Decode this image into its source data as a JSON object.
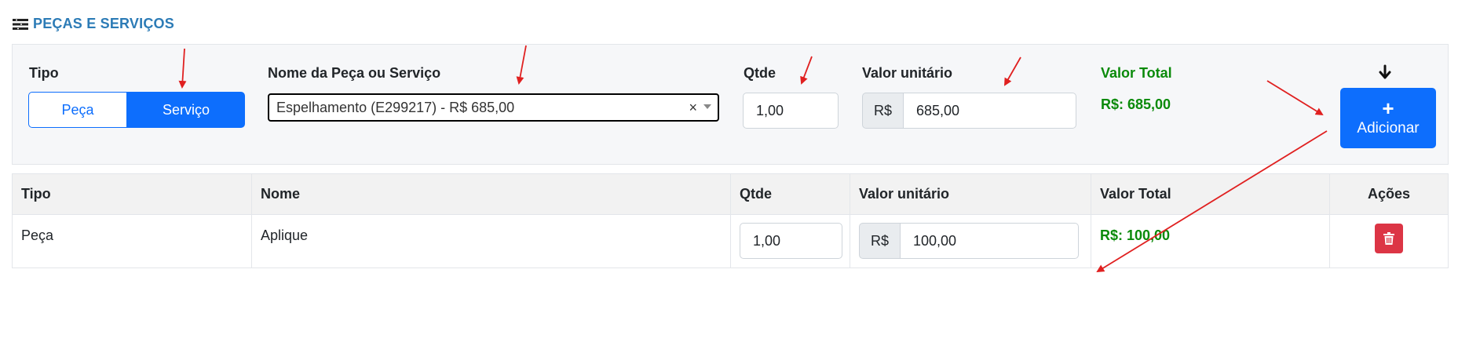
{
  "section": {
    "title": "PEÇAS E SERVIÇOS",
    "icon": "list-icon"
  },
  "form": {
    "tipo_label": "Tipo",
    "tipo_options": [
      "Peça",
      "Serviço"
    ],
    "tipo_selected": "Serviço",
    "nome_label": "Nome da Peça ou Serviço",
    "nome_value": "Espelhamento (E299217) - R$ 685,00",
    "nome_clear": "×",
    "qtde_label": "Qtde",
    "qtde_value": "1,00",
    "valor_label": "Valor unitário",
    "currency": "R$",
    "valor_value": "685,00",
    "total_label": "Valor Total",
    "total_value": "R$: 685,00",
    "add_label": "Adicionar",
    "add_plus": "+"
  },
  "table": {
    "headers": [
      "Tipo",
      "Nome",
      "Qtde",
      "Valor unitário",
      "Valor Total",
      "Ações"
    ],
    "rows": [
      {
        "tipo": "Peça",
        "nome": "Aplique",
        "qtde": "1,00",
        "currency": "R$",
        "valor": "100,00",
        "total": "R$: 100,00"
      }
    ]
  },
  "colors": {
    "primary": "#0d6efd",
    "danger": "#dc3545",
    "success": "#0a8a0a",
    "title": "#2c7bb6",
    "annotation": "#e02020"
  }
}
